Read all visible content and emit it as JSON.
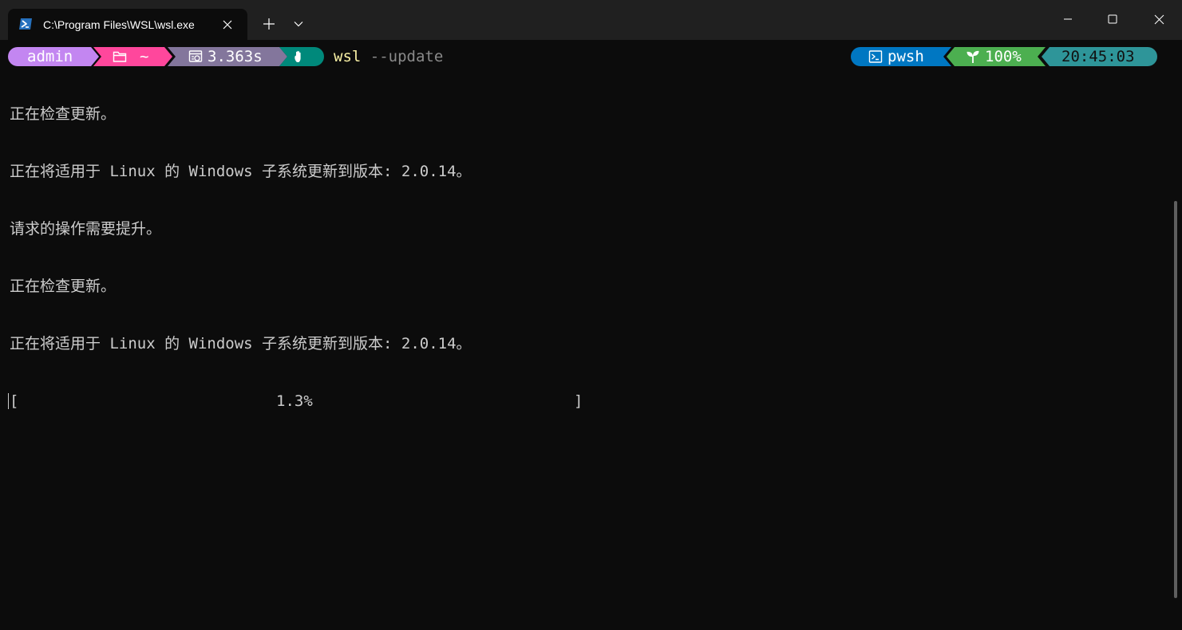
{
  "tab": {
    "title": "C:\\Program Files\\WSL\\wsl.exe",
    "icon": "powershell-icon"
  },
  "titlebar": {
    "new_tab_icon": "plus-icon",
    "dropdown_icon": "chevron-down-icon",
    "minimize_icon": "minimize-icon",
    "maximize_icon": "maximize-icon",
    "close_icon": "close-icon"
  },
  "prompt": {
    "user": "admin",
    "path": "~",
    "execution_time": "3.363s",
    "status_icon": "hand-icon",
    "command": "wsl",
    "args": "--update",
    "shell": "pwsh",
    "battery": "100%",
    "time": "20:45:03"
  },
  "output": {
    "lines": [
      "正在检查更新。",
      "正在将适用于 Linux 的 Windows 子系统更新到版本: 2.0.14。",
      "请求的操作需要提升。",
      "正在检查更新。",
      "正在将适用于 Linux 的 Windows 子系统更新到版本: 2.0.14。"
    ],
    "progress": {
      "open": "[",
      "percent": "1.3%",
      "close": "]"
    }
  },
  "colors": {
    "user": "#c386f1",
    "path": "#ff479c",
    "exec": "#83769c",
    "status": "#00897b",
    "shell": "#0077c2",
    "battery": "#4caf50",
    "time": "#2e9599",
    "command": "#f9f1a5",
    "args": "#8a8a8a",
    "text": "#cccccc",
    "background": "#0c0c0c"
  }
}
